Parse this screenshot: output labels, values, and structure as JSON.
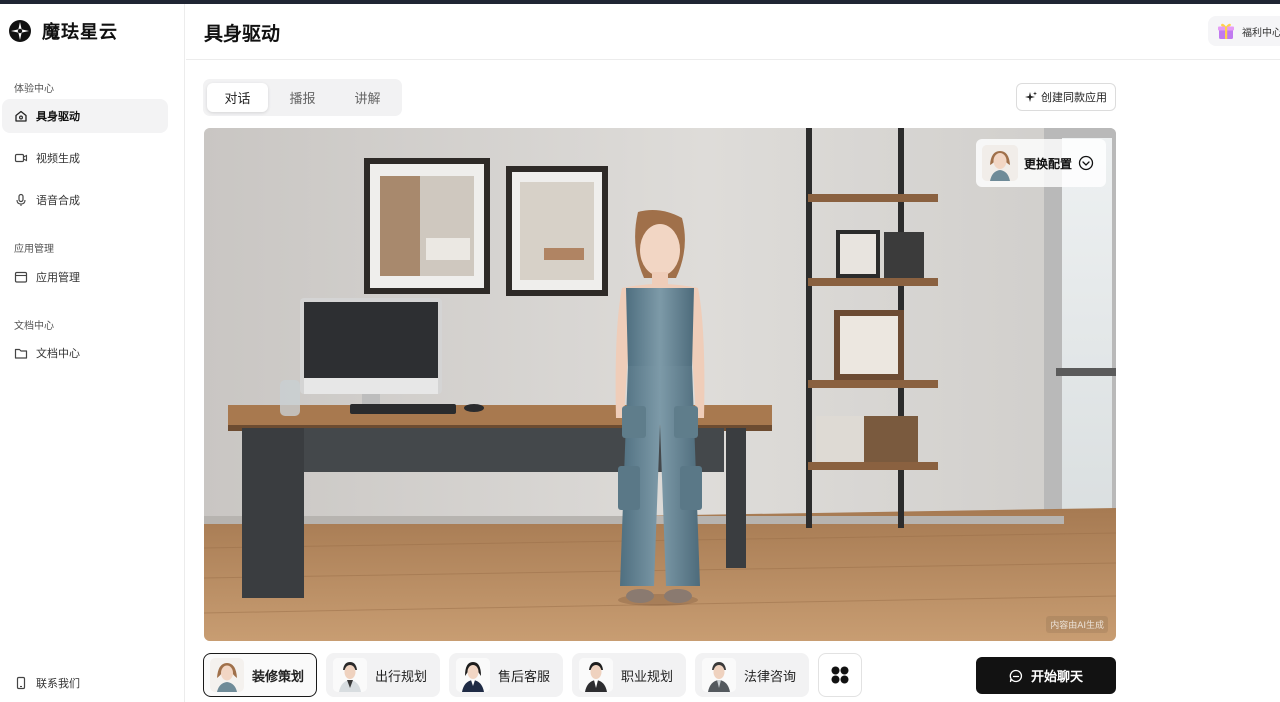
{
  "brand": {
    "name": "魔珐星云",
    "logo_icon": "star-compass-icon"
  },
  "sidebar": {
    "sections": [
      {
        "title": "体验中心",
        "items": [
          {
            "label": "具身驱动",
            "icon": "home-icon",
            "active": true
          },
          {
            "label": "视频生成",
            "icon": "video-camera-icon"
          },
          {
            "label": "语音合成",
            "icon": "microphone-icon"
          }
        ]
      },
      {
        "title": "应用管理",
        "items": [
          {
            "label": "应用管理",
            "icon": "archive-box-icon"
          }
        ]
      },
      {
        "title": "文档中心",
        "items": [
          {
            "label": "文档中心",
            "icon": "folder-icon"
          }
        ]
      }
    ],
    "footer": {
      "label": "联系我们",
      "icon": "phone-icon"
    }
  },
  "header": {
    "title": "具身驱动",
    "welfare_label": "福利中心",
    "welfare_icon": "gift-icon"
  },
  "tabs": [
    {
      "label": "对话",
      "active": true
    },
    {
      "label": "播报"
    },
    {
      "label": "讲解"
    }
  ],
  "create_button": {
    "label": "创建同款应用",
    "icon": "sparkle-icon"
  },
  "stage": {
    "config_label": "更换配置",
    "ai_note": "内容由AI生成"
  },
  "characters": [
    {
      "label": "装修策划",
      "active": true
    },
    {
      "label": "出行规划"
    },
    {
      "label": "售后客服"
    },
    {
      "label": "职业规划"
    },
    {
      "label": "法律咨询"
    }
  ],
  "more_icon": "grid-dots-icon",
  "start_button": {
    "label": "开始聊天",
    "icon": "chat-bubble-icon"
  },
  "colors": {
    "accent_dark": "#121212",
    "sidebar_active_bg": "#f3f3f4"
  }
}
